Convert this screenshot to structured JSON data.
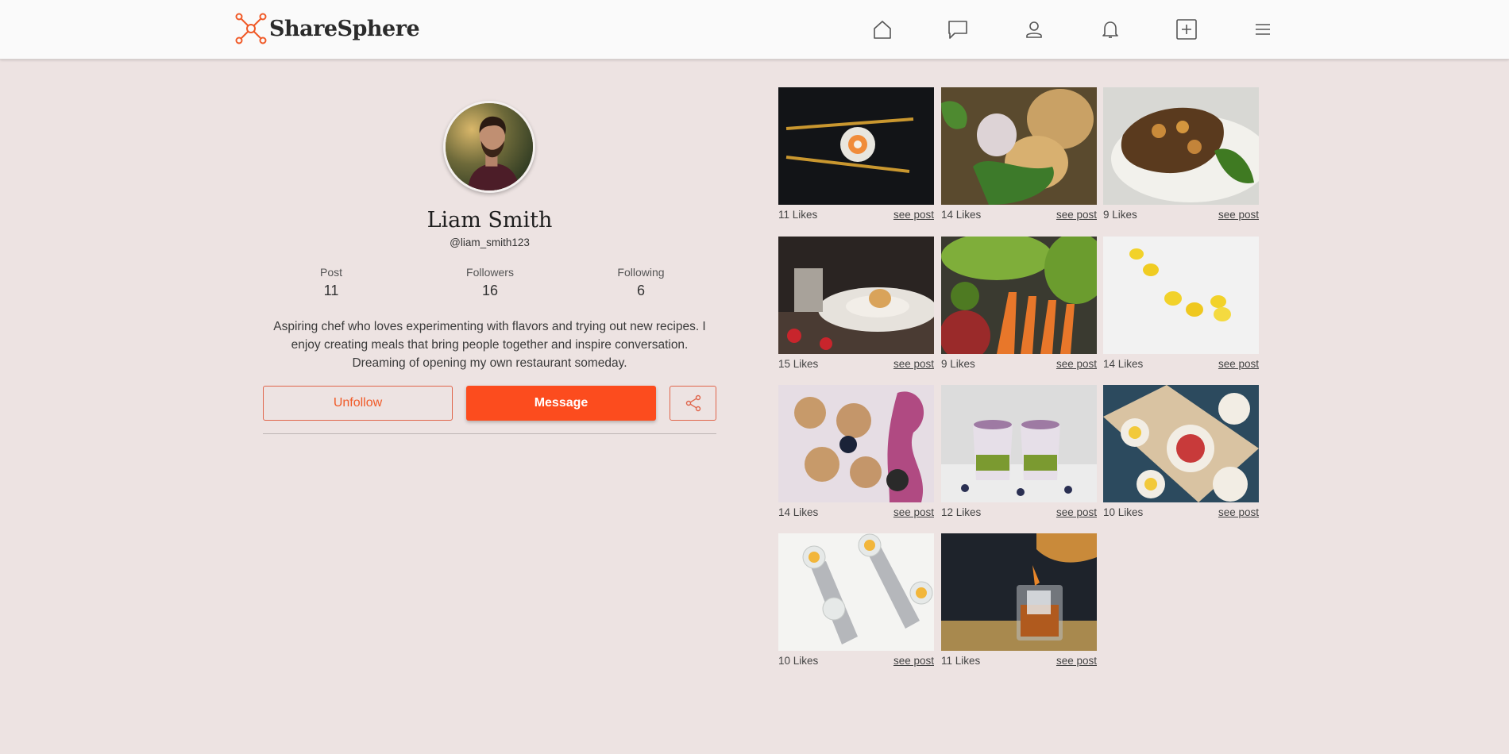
{
  "brand": {
    "name": "ShareSphere",
    "accent": "#f05a28"
  },
  "nav": [
    {
      "name": "home-icon"
    },
    {
      "name": "chat-icon"
    },
    {
      "name": "profile-icon"
    },
    {
      "name": "bell-icon"
    },
    {
      "name": "add-post-icon"
    },
    {
      "name": "menu-icon"
    }
  ],
  "profile": {
    "name": "Liam Smith",
    "handle": "@liam_smith123",
    "stats": {
      "post": {
        "label": "Post",
        "value": "11"
      },
      "followers": {
        "label": "Followers",
        "value": "16"
      },
      "following": {
        "label": "Following",
        "value": "6"
      }
    },
    "bio": "Aspiring chef who loves experimenting with flavors and trying out new recipes. I enjoy creating meals that bring people together and inspire conversation. Dreaming of opening my own restaurant someday.",
    "unfollow_label": "Unfollow",
    "message_label": "Message"
  },
  "posts": [
    {
      "likes": "11 Likes",
      "link": "see post"
    },
    {
      "likes": "14 Likes",
      "link": "see post"
    },
    {
      "likes": "9 Likes",
      "link": "see post"
    },
    {
      "likes": "15 Likes",
      "link": "see post"
    },
    {
      "likes": "9 Likes",
      "link": "see post"
    },
    {
      "likes": "14 Likes",
      "link": "see post"
    },
    {
      "likes": "14 Likes",
      "link": "see post"
    },
    {
      "likes": "12 Likes",
      "link": "see post"
    },
    {
      "likes": "10 Likes",
      "link": "see post"
    },
    {
      "likes": "10 Likes",
      "link": "see post"
    },
    {
      "likes": "11 Likes",
      "link": "see post"
    }
  ]
}
